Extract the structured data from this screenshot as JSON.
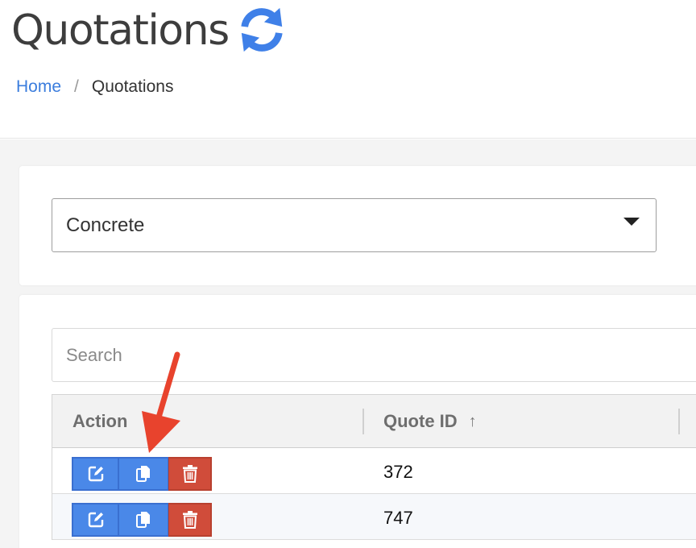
{
  "page": {
    "title": "Quotations"
  },
  "breadcrumb": {
    "home": "Home",
    "separator": "/",
    "current": "Quotations"
  },
  "filter": {
    "selected": "Concrete"
  },
  "search": {
    "placeholder": "Search"
  },
  "table": {
    "columns": {
      "action": "Action",
      "quote_id": "Quote ID",
      "sort_indicator": "↑"
    },
    "rows": [
      {
        "quote_id": "372"
      },
      {
        "quote_id": "747"
      }
    ]
  },
  "icons": [
    "refresh-icon",
    "edit-icon",
    "copy-icon",
    "trash-icon",
    "caret-down-icon",
    "sort-up-icon"
  ],
  "colors": {
    "accent": "#3b7ddd",
    "button_blue": "#4a88e8",
    "button_red": "#d04c3a",
    "annotation_arrow": "#e8432d"
  }
}
